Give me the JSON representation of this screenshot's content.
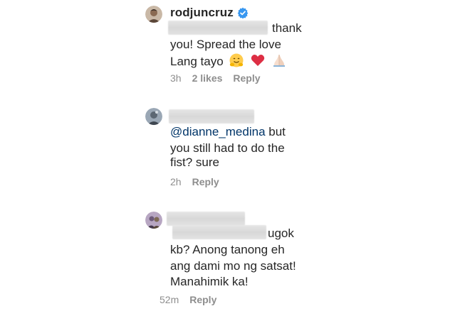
{
  "comments": [
    {
      "username": "rodjuncruz",
      "verified": true,
      "text_lines": [
        "thank",
        "you! Spread the love",
        "Lang tayo"
      ],
      "emojis": [
        "hugging-face-icon",
        "red-heart-icon",
        "folded-hands-icon"
      ],
      "time": "3h",
      "likes": "2 likes",
      "reply": "Reply"
    },
    {
      "mention": "@dianne_medina",
      "text_lines": [
        " but",
        "you still had to do the",
        "fist? sure"
      ],
      "time": "2h",
      "reply": "Reply"
    },
    {
      "text_lines": [
        "ugok",
        "kb? Anong tanong eh",
        "ang dami mo ng satsat!",
        "Manahimik ka!"
      ],
      "time": "52m",
      "reply": "Reply"
    }
  ],
  "colors": {
    "text": "#262626",
    "meta": "#8e8e8e",
    "mention": "#003569",
    "verified_badge": "#3897f0"
  }
}
